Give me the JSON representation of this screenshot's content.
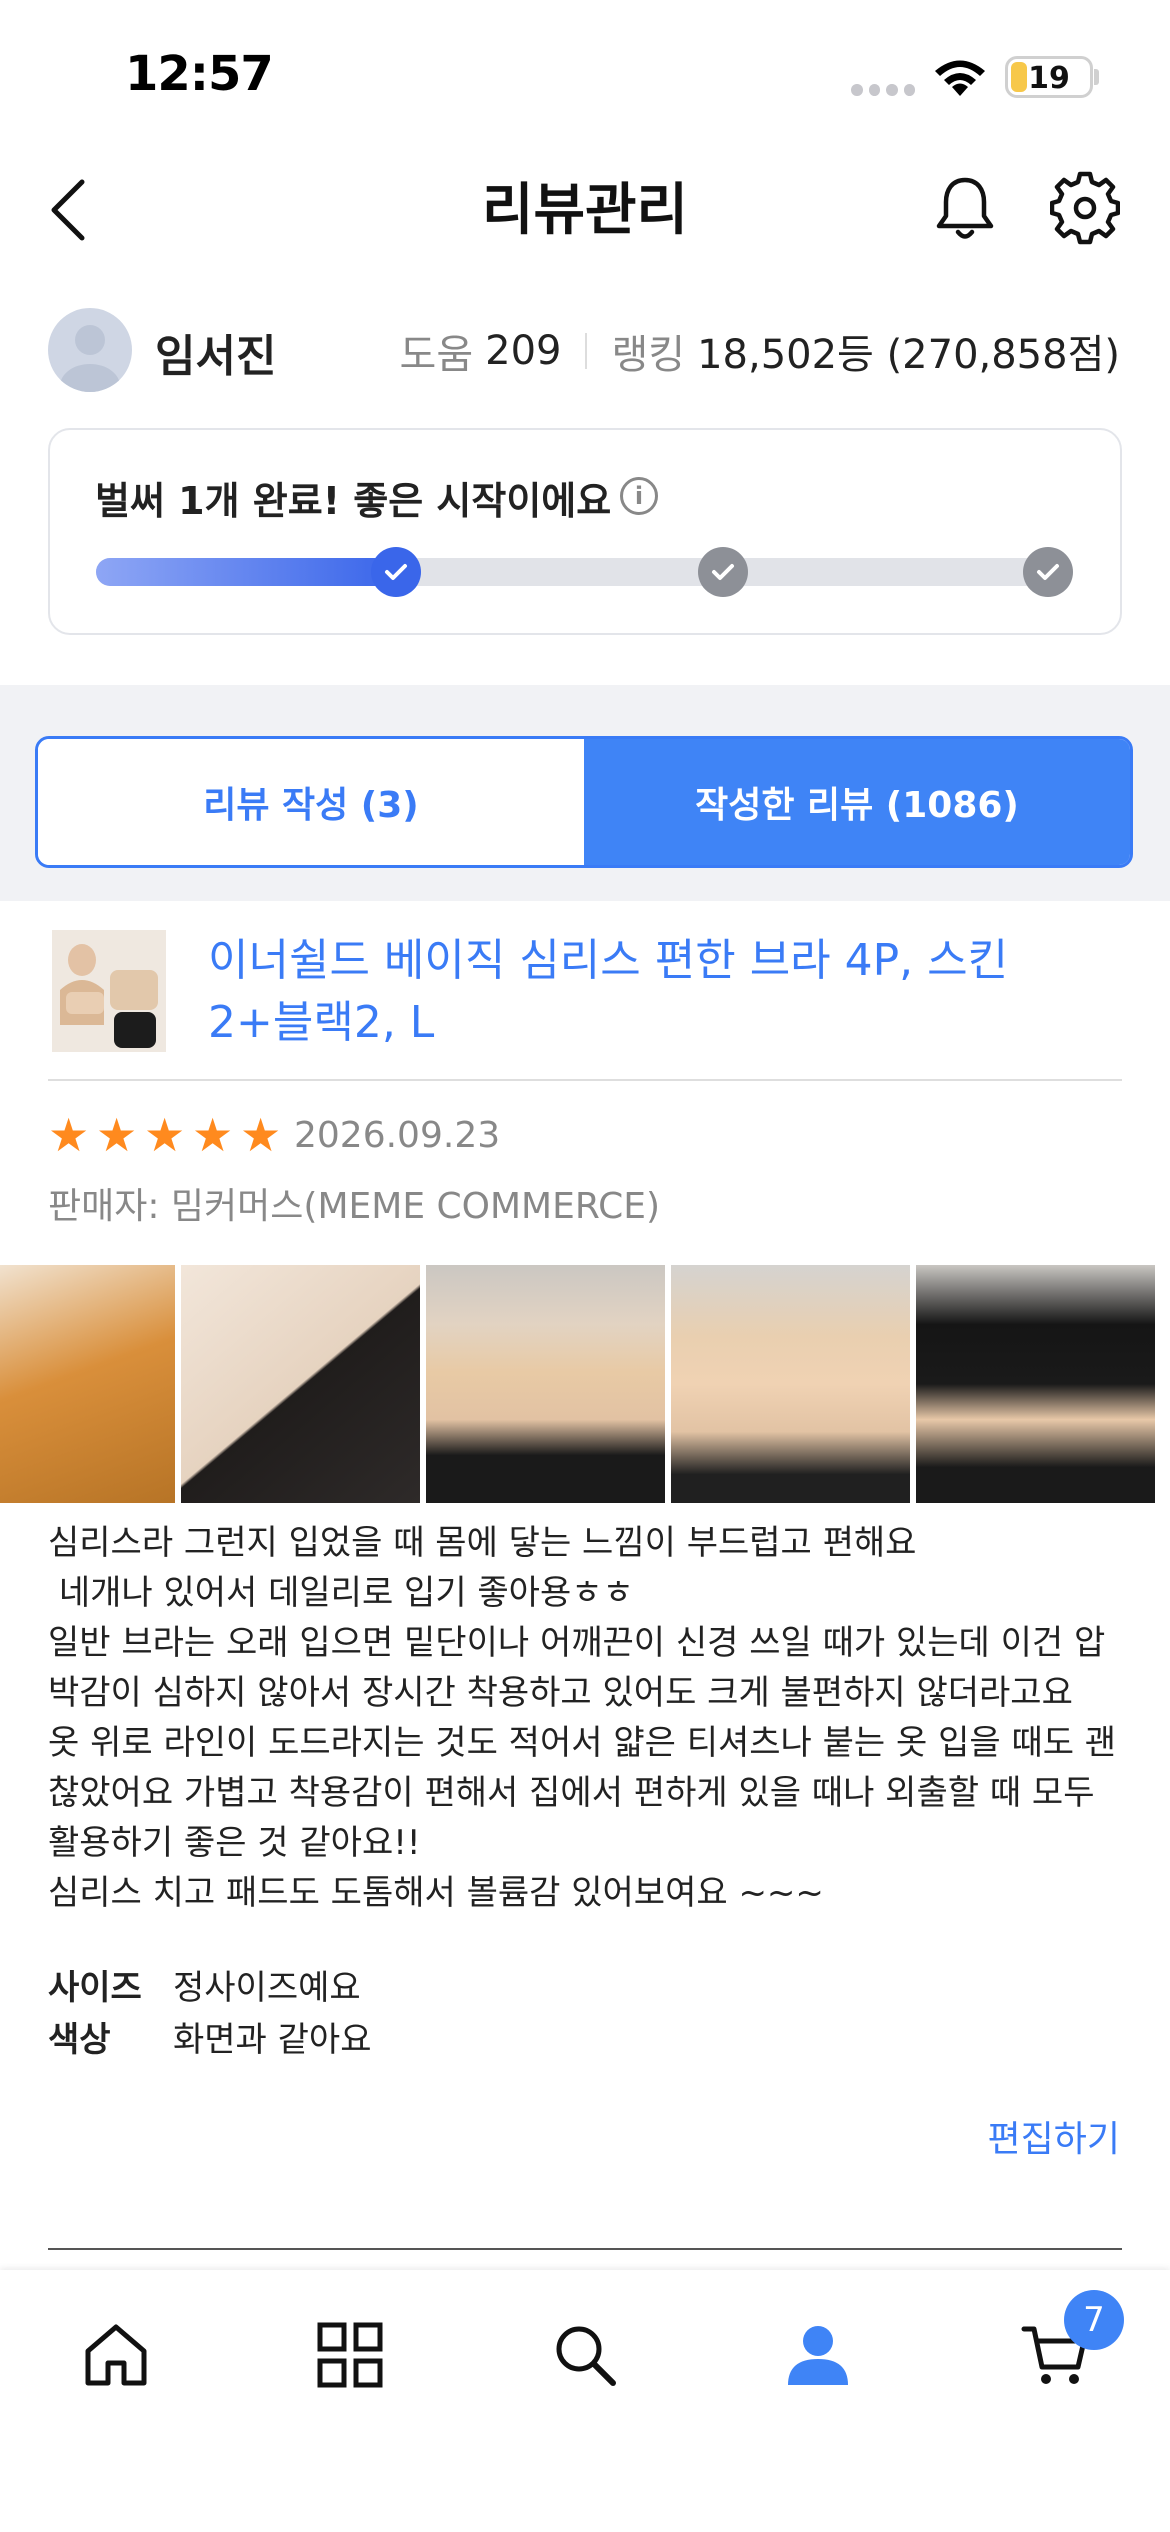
{
  "status_bar": {
    "time": "12:57",
    "battery": "19"
  },
  "header": {
    "title": "리뷰관리"
  },
  "profile": {
    "name": "임서진",
    "help_label": "도움",
    "help_value": "209",
    "ranking_label": "랭킹",
    "ranking_value": "18,502등 (270,858점)"
  },
  "progress": {
    "message": "벌써 1개 완료! 좋은 시작이에요",
    "completed_fraction": 0.33
  },
  "tabs": [
    {
      "label": "리뷰 작성 (3)",
      "active": false
    },
    {
      "label": "작성한 리뷰 (1086)",
      "active": true
    }
  ],
  "review": {
    "product_title": "이너쉴드 베이직 심리스 편한 브라 4P, 스킨 2+블랙2, L",
    "rating": 5,
    "date": "2026.09.23",
    "seller": "판매자: 밈커머스(MEME COMMERCE)",
    "body": "심리스라 그런지 입었을 때 몸에 닿는 느낌이 부드럽고 편해요\n 네개나 있어서 데일리로 입기 좋아용ㅎㅎ\n일반 브라는 오래 입으면 밑단이나 어깨끈이 신경 쓰일 때가 있는데 이건 압박감이 심하지 않아서 장시간 착용하고 있어도 크게 불편하지 않더라고요\n옷 위로 라인이 도드라지는 것도 적어서 얇은 티셔츠나 붙는 옷 입을 때도 괜찮았어요 가볍고 착용감이 편해서 집에서 편하게 있을 때나 외출할 때 모두 활용하기 좋은 것 같아요!!\n심리스 치고 패드도 도톰해서 볼륨감 있어보여요 ~~~",
    "attributes": [
      {
        "key": "사이즈",
        "value": "정사이즈예요"
      },
      {
        "key": "색상",
        "value": "화면과 같아요"
      }
    ],
    "edit_label": "편집하기"
  },
  "bottom_nav": {
    "items": [
      "home-icon",
      "categories-icon",
      "search-icon",
      "my-page-icon",
      "cart-icon"
    ],
    "cart_count": "7",
    "active_color": "#3f84f6"
  },
  "colors": {
    "accent": "#3a7bf6",
    "star": "#ff8a1e"
  }
}
